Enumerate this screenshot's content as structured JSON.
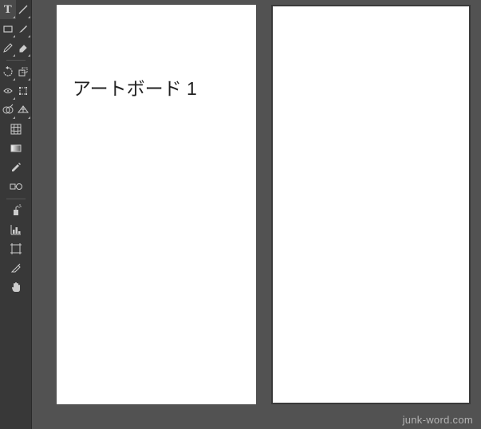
{
  "toolbar": {
    "tools": [
      {
        "name": "type-tool",
        "icon": "type-icon",
        "label": "T"
      },
      {
        "name": "line-segment-tool",
        "icon": "line-icon"
      },
      {
        "name": "rectangle-tool",
        "icon": "rectangle-icon"
      },
      {
        "name": "paintbrush-tool",
        "icon": "paintbrush-icon"
      },
      {
        "name": "pencil-tool",
        "icon": "pencil-icon"
      },
      {
        "name": "eraser-tool",
        "icon": "eraser-icon"
      },
      {
        "name": "rotate-tool",
        "icon": "rotate-icon"
      },
      {
        "name": "scale-tool",
        "icon": "scale-icon"
      },
      {
        "name": "width-tool",
        "icon": "width-icon"
      },
      {
        "name": "free-transform-tool",
        "icon": "free-transform-icon"
      },
      {
        "name": "shape-builder-tool",
        "icon": "shape-builder-icon"
      },
      {
        "name": "perspective-grid-tool",
        "icon": "perspective-grid-icon"
      },
      {
        "name": "mesh-tool",
        "icon": "mesh-icon"
      },
      {
        "name": "gradient-tool",
        "icon": "gradient-icon"
      },
      {
        "name": "eyedropper-tool",
        "icon": "eyedropper-icon"
      },
      {
        "name": "blend-tool",
        "icon": "blend-icon"
      },
      {
        "name": "symbol-sprayer-tool",
        "icon": "symbol-sprayer-icon"
      },
      {
        "name": "column-graph-tool",
        "icon": "column-graph-icon"
      },
      {
        "name": "artboard-tool",
        "icon": "artboard-icon"
      },
      {
        "name": "slice-tool",
        "icon": "slice-icon"
      },
      {
        "name": "hand-tool",
        "icon": "hand-icon"
      }
    ]
  },
  "canvas": {
    "artboards": [
      {
        "label": "アートボード 1"
      },
      {
        "label": ""
      }
    ]
  },
  "watermark": "junk-word.com"
}
